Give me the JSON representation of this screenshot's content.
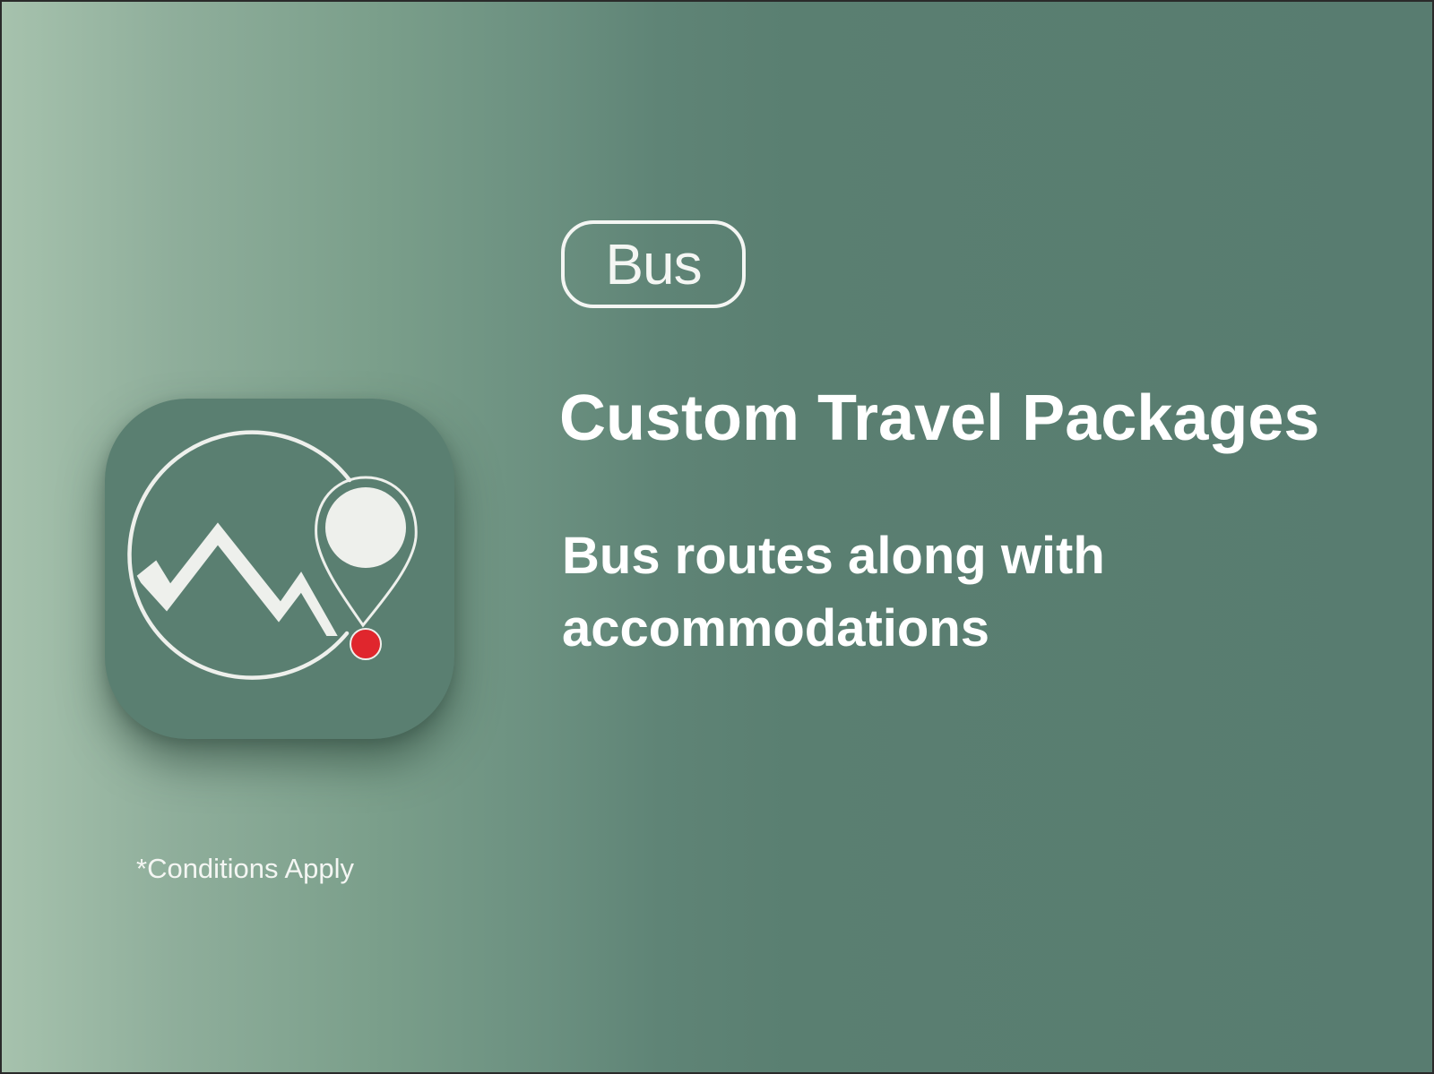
{
  "promo": {
    "mode_tag": "Bus",
    "headline": "Custom Travel Packages",
    "subheadline": "Bus routes along with accommodations",
    "disclaimer": "*Conditions Apply"
  },
  "icons": {
    "app_icon": "mountain-location-pin-icon"
  },
  "colors": {
    "background_left": "#a6c2ad",
    "background_right": "#587c70",
    "icon_tile": "#5a7f71",
    "line_art": "#eef0ec",
    "location_dot": "#e0262d",
    "text": "#ffffff"
  }
}
